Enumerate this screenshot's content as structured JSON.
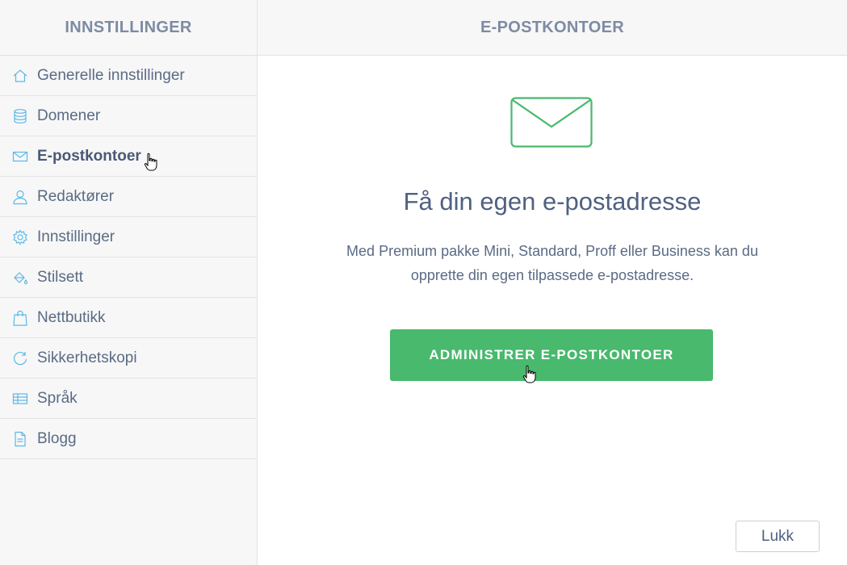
{
  "sidebar": {
    "title": "INNSTILLINGER",
    "items": [
      {
        "label": "Generelle innstillinger",
        "icon": "home-icon"
      },
      {
        "label": "Domener",
        "icon": "database-icon"
      },
      {
        "label": "E-postkontoer",
        "icon": "mail-icon",
        "active": true
      },
      {
        "label": "Redaktører",
        "icon": "user-icon"
      },
      {
        "label": "Innstillinger",
        "icon": "gear-icon"
      },
      {
        "label": "Stilsett",
        "icon": "paint-bucket-icon"
      },
      {
        "label": "Nettbutikk",
        "icon": "shopping-bag-icon"
      },
      {
        "label": "Sikkerhetskopi",
        "icon": "refresh-icon"
      },
      {
        "label": "Språk",
        "icon": "language-table-icon"
      },
      {
        "label": "Blogg",
        "icon": "document-icon"
      }
    ]
  },
  "main": {
    "title": "E-POSTKONTOER",
    "icon": "envelope-icon",
    "headline": "Få din egen e-postadresse",
    "description_line1": "Med Premium pakke Mini, Standard, Proff eller Business kan du",
    "description_line2": "opprette din egen tilpassede e-postadresse.",
    "cta_label": "ADMINISTRER E-POSTKONTOER",
    "close_label": "Lukk"
  },
  "colors": {
    "accent_green": "#48b96d",
    "icon_blue": "#5bb8e8",
    "text_slate": "#5a6b85",
    "header_grey": "#7d8ba3"
  }
}
